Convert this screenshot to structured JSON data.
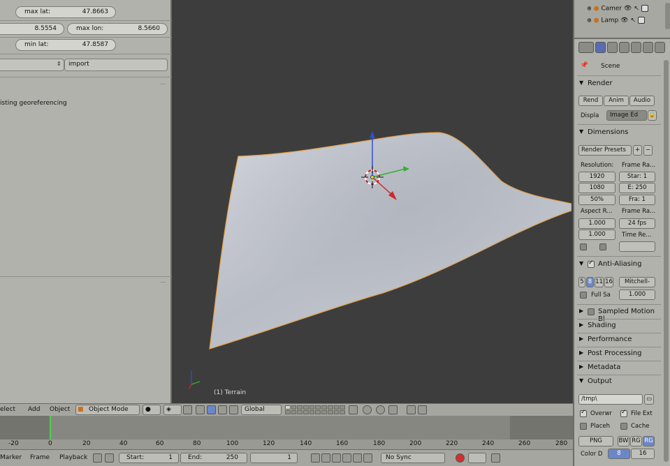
{
  "left_panel": {
    "rows": [
      {
        "label": "max lat:",
        "value": "47.8663"
      },
      {
        "left_value": "8.5554",
        "label": "max lon:",
        "value": "8.5660"
      },
      {
        "label": "min lat:",
        "value": "47.8587"
      }
    ],
    "import_label": "import",
    "text_fragment": "isting georeferencing"
  },
  "viewport": {
    "object_label": "(1) Terrain"
  },
  "outliner": {
    "items": [
      {
        "label": "Camer"
      },
      {
        "label": "Lamp"
      }
    ]
  },
  "properties": {
    "scene_label": "Scene",
    "render": {
      "title": "Render",
      "buttons": [
        "Rend",
        "Anim",
        "Audio"
      ],
      "display_label": "Displa",
      "display_value": "Image Ed"
    },
    "dimensions": {
      "title": "Dimensions",
      "presets": "Render Presets",
      "resolution_label": "Resolution:",
      "res_x": "1920",
      "res_y": "1080",
      "res_pct": "50%",
      "frame_range_label": "Frame Ra...",
      "frame_start": "Star: 1",
      "frame_end": "E: 250",
      "frame_step": "Fra: 1",
      "aspect_label": "Aspect R...",
      "aspect_x": "1.000",
      "aspect_y": "1.000",
      "frame_rate_label": "Frame Ra...",
      "fps": "24 fps",
      "time_remap_label": "Time Re..."
    },
    "anti_aliasing": {
      "title": "Anti-Aliasing",
      "samples": [
        "5",
        "8",
        "11",
        "16"
      ],
      "selected_sample": "8",
      "filter": "Mitchell-",
      "full_sample": "Full Sa",
      "filter_size": "1.000"
    },
    "collapsed_sections": [
      "Sampled Motion Bl",
      "Shading",
      "Performance",
      "Post Processing",
      "Metadata"
    ],
    "output": {
      "title": "Output",
      "path": "/tmp\\",
      "overwrite": "Overwr",
      "file_ext": "File Ext",
      "placeholders": "Placeh",
      "cache": "Cache",
      "format": "PNG",
      "color_modes": [
        "BW",
        "RG",
        "RG"
      ],
      "color_depth_label": "Color D",
      "depth_values": [
        "8",
        "16"
      ]
    }
  },
  "view_header": {
    "menu": [
      "elect",
      "Add",
      "Object"
    ],
    "mode": "Object Mode",
    "orientation": "Global"
  },
  "timeline": {
    "ticks": [
      "-20",
      "0",
      "20",
      "40",
      "60",
      "80",
      "100",
      "120",
      "140",
      "160",
      "180",
      "200",
      "220",
      "240",
      "260",
      "280"
    ],
    "current_frame": 0,
    "menu": [
      "Marker",
      "Frame",
      "Playback"
    ],
    "start_label": "Start:",
    "start_value": "1",
    "end_label": "End:",
    "end_value": "250",
    "current_value": "1",
    "sync": "No Sync"
  },
  "colors": {
    "panel": "#b2b2ac",
    "viewport_bg": "#3d3d3d",
    "terrain": "#c8ccd3",
    "selection_outline": "#e8a040",
    "accent_blue": "#6b87c8",
    "frame_cursor": "#50d050"
  }
}
